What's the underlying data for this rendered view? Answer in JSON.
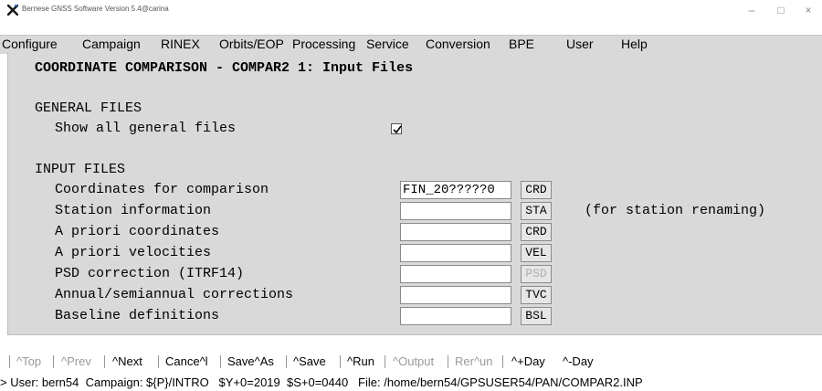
{
  "window": {
    "title": "Bernese GNSS Software Version 5.4@carina",
    "minimize_glyph": "–",
    "maximize_glyph": "□",
    "close_glyph": "×"
  },
  "menu": [
    "Configure",
    "Campaign",
    "RINEX",
    "Orbits/EOP",
    "Processing",
    "Service",
    "Conversion",
    "BPE",
    "User",
    "Help"
  ],
  "panel": {
    "title": "COORDINATE COMPARISON - COMPAR2 1: Input Files",
    "general_section": "GENERAL FILES",
    "show_all_label": "Show all general files",
    "show_all_checked": true,
    "input_section": "INPUT FILES",
    "rows": [
      {
        "label": "Coordinates for comparison",
        "value": "FIN_20?????0",
        "ext": "CRD",
        "ext_enabled": true
      },
      {
        "label": "Station information",
        "value": "",
        "ext": "STA",
        "ext_enabled": true
      },
      {
        "label": "A priori coordinates",
        "value": "",
        "ext": "CRD",
        "ext_enabled": true
      },
      {
        "label": "A priori velocities",
        "value": "",
        "ext": "VEL",
        "ext_enabled": true
      },
      {
        "label": "PSD correction (ITRF14)",
        "value": "",
        "ext": "PSD",
        "ext_enabled": false
      },
      {
        "label": "Annual/semiannual corrections",
        "value": "",
        "ext": "TVC",
        "ext_enabled": true
      },
      {
        "label": "Baseline definitions",
        "value": "",
        "ext": "BSL",
        "ext_enabled": true
      }
    ],
    "station_note": "(for station renaming)"
  },
  "actions": [
    {
      "label": "^Top",
      "enabled": false
    },
    {
      "label": "^Prev",
      "enabled": false
    },
    {
      "label": "^Next",
      "enabled": true
    },
    {
      "label": "Cance^l",
      "enabled": true
    },
    {
      "label": "Save^As",
      "enabled": true
    },
    {
      "label": "^Save",
      "enabled": true
    },
    {
      "label": "^Run",
      "enabled": true
    },
    {
      "label": "^Output",
      "enabled": false
    },
    {
      "label": "Rer^un",
      "enabled": false
    },
    {
      "label": "^+Day",
      "enabled": true
    },
    {
      "label": "^-Day",
      "enabled": true
    }
  ],
  "status": "> User: bern54  Campaign: ${P}/INTRO   $Y+0=2019  $S+0=0440   File: /home/bern54/GPSUSER54/PAN/COMPAR2.INP"
}
